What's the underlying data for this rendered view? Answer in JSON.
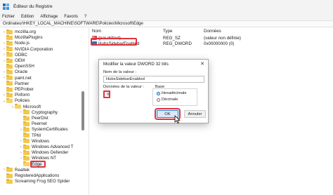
{
  "window": {
    "title": "Éditeur du Registre"
  },
  "menu": [
    "Fichier",
    "Edition",
    "Affichage",
    "Favoris",
    "?"
  ],
  "address": "Ordinateur\\HKEY_LOCAL_MACHINE\\SOFTWARE\\Policies\\Microsoft\\Edge",
  "tree": {
    "items": [
      {
        "label": "mozilla.org",
        "expand": "›"
      },
      {
        "label": "MozillaPlugins",
        "expand": ""
      },
      {
        "label": "Node.js",
        "expand": "›"
      },
      {
        "label": "NVIDIA Corporation",
        "expand": "›"
      },
      {
        "label": "ODBC",
        "expand": "›"
      },
      {
        "label": "OEM",
        "expand": "›"
      },
      {
        "label": "OpenSSH",
        "expand": ""
      },
      {
        "label": "Oracle",
        "expand": "›"
      },
      {
        "label": "paint.net",
        "expand": "›"
      },
      {
        "label": "Partner",
        "expand": ""
      },
      {
        "label": "PEProber",
        "expand": ""
      },
      {
        "label": "Piriform",
        "expand": "›"
      },
      {
        "label": "Policies",
        "expand": "⌄"
      },
      {
        "label": "Microsoft",
        "expand": "⌄"
      },
      {
        "label": "Cryptography",
        "expand": "›"
      },
      {
        "label": "PeerDist",
        "expand": ""
      },
      {
        "label": "Peernet",
        "expand": ""
      },
      {
        "label": "SystemCertificates",
        "expand": "›"
      },
      {
        "label": "TPM",
        "expand": ""
      },
      {
        "label": "Windows",
        "expand": "›"
      },
      {
        "label": "Windows Advanced T",
        "expand": "›"
      },
      {
        "label": "Windows Defender",
        "expand": "›"
      },
      {
        "label": "Windows NT",
        "expand": "›"
      },
      {
        "label": "Edge",
        "expand": ""
      },
      {
        "label": "Realtek",
        "expand": "›"
      },
      {
        "label": "RegisteredApplications",
        "expand": ""
      },
      {
        "label": "Screaming Frog SEO Spider",
        "expand": ""
      }
    ]
  },
  "list": {
    "headers": {
      "name": "Nom",
      "type": "Type",
      "data": "Données"
    },
    "rows": [
      {
        "name": "(par défaut)",
        "type": "REG_SZ",
        "data": "(valeur non définie)",
        "icon": "string-value-icon"
      },
      {
        "name": "HubsSidebarEnabled",
        "type": "REG_DWORD",
        "data": "0x00000000 (0)",
        "icon": "dword-value-icon"
      }
    ]
  },
  "dialog": {
    "title": "Modifier la valeur DWORD 32 bits",
    "close": "✕",
    "name_label": "Nom de la valeur :",
    "name_value": "HubsSidebarEnabled",
    "data_label": "Données de la valeur :",
    "data_value": "0",
    "base_label": "Base",
    "hex_label": "Hexadécimale",
    "dec_label": "Décimale",
    "ok_label": "OK",
    "cancel_label": "Annuler"
  },
  "colors": {
    "highlight": "#e0333a",
    "accent": "#005fb8",
    "folder": "#f2c84b"
  }
}
